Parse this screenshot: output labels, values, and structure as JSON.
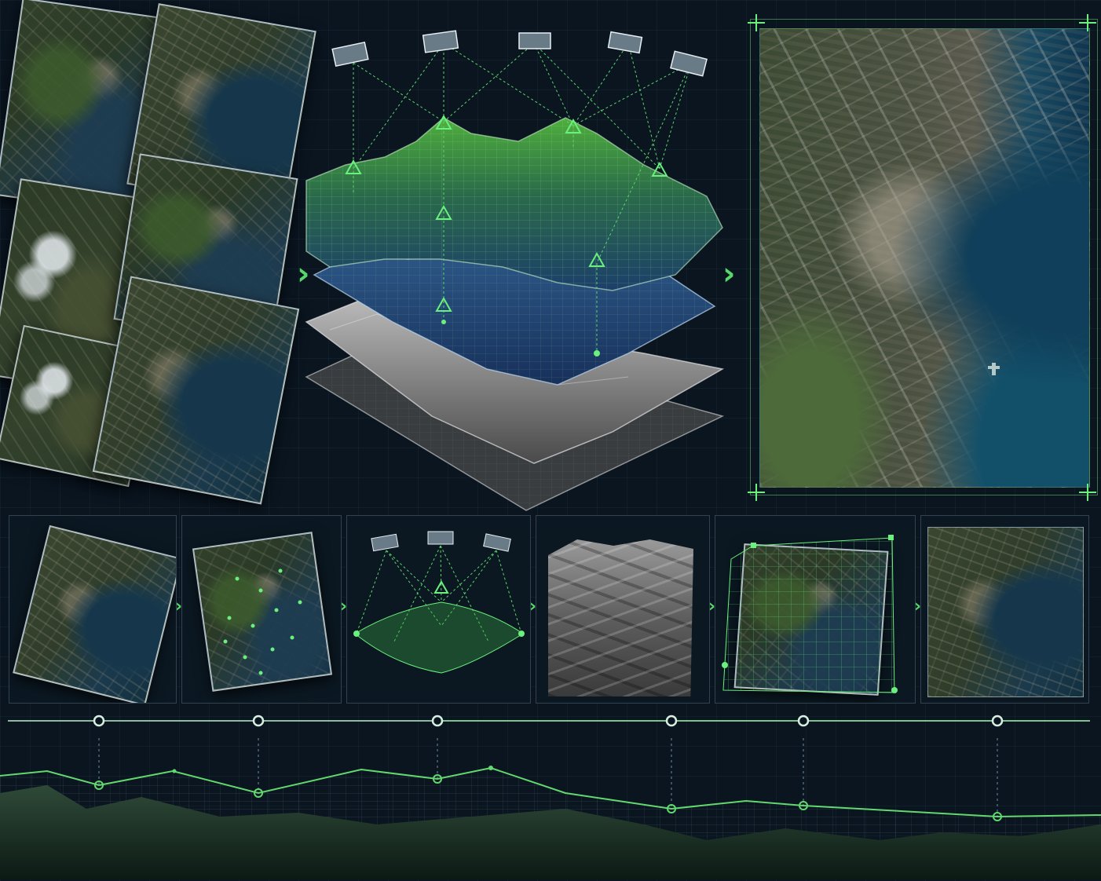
{
  "figure": {
    "stages_top": [
      "aerial-photo-set",
      "terrain-reconstruction-layers",
      "orthomosaic-map"
    ],
    "stages_bottom": [
      "overlapping-imagery",
      "feature-matching",
      "camera-triangulation",
      "elevation-model",
      "georeferencing-warp",
      "final-orthophoto"
    ],
    "timeline_nodes": 6,
    "profile_nodes": 6
  },
  "colors": {
    "background": "#0a1520",
    "accent_green": "#56d86a",
    "grid_line": "#1c3142",
    "node_stroke": "#cfe8d6"
  },
  "icons": {
    "flow_arrow": "chevron-right-icon",
    "camera": "camera-icon",
    "control_point": "control-point-icon",
    "corner": "corner-crosshair-icon"
  }
}
